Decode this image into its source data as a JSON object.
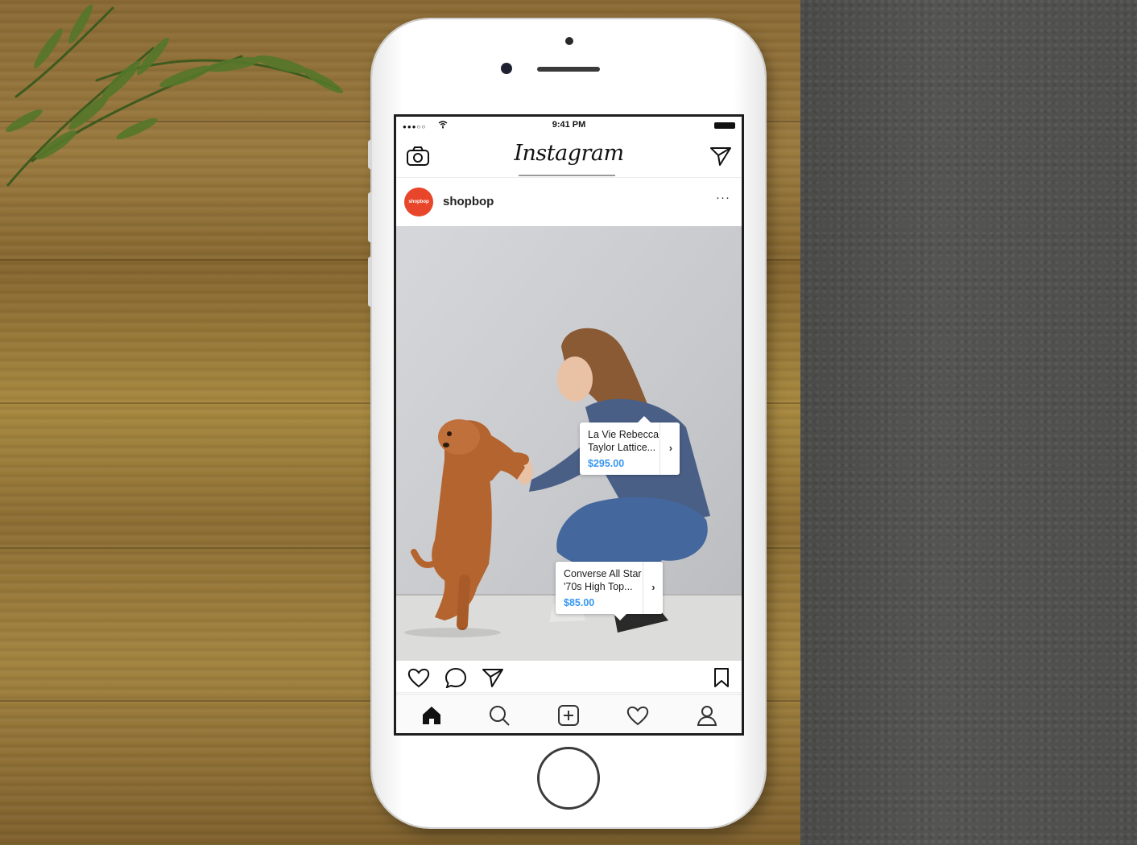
{
  "status_bar": {
    "signal": "●●●○○",
    "time": "9:41 PM"
  },
  "app": {
    "logo_text": "Instagram"
  },
  "post": {
    "avatar_text": "shopbop",
    "username": "shopbop",
    "more_label": "···",
    "tags": [
      {
        "name_line1": "La Vie Rebecca",
        "name_line2": "Taylor Lattice...",
        "price": "$295.00"
      },
      {
        "name_line1": "Converse All Star",
        "name_line2": "'70s High Top...",
        "price": "$85.00"
      }
    ],
    "tag_arrow": "›"
  },
  "icons": {
    "header": [
      "camera-icon",
      "direct-message-icon"
    ],
    "actions": [
      "heart-icon",
      "comment-icon",
      "share-icon",
      "bookmark-icon"
    ],
    "tabs": [
      "home-icon",
      "search-icon",
      "add-post-icon",
      "activity-heart-icon",
      "profile-icon"
    ]
  },
  "colors": {
    "brand_avatar": "#e8462a",
    "price_link": "#3897f0"
  }
}
